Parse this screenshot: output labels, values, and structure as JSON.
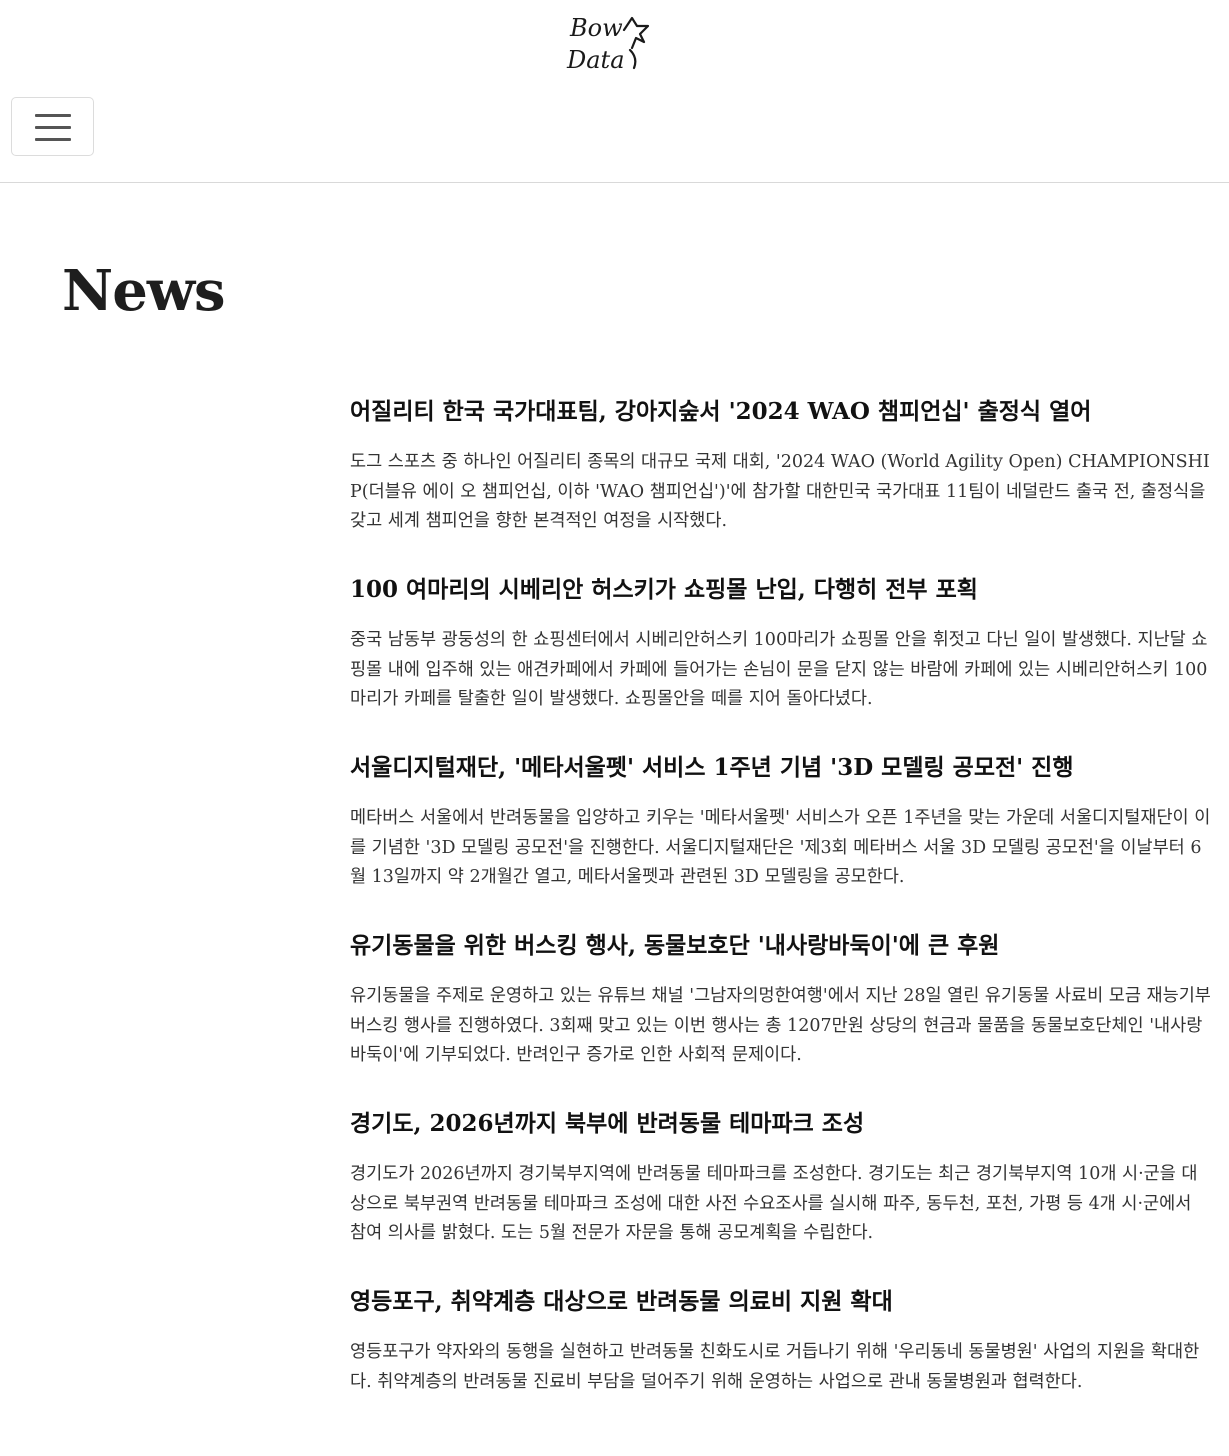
{
  "header": {
    "logo_line1": "Bow",
    "logo_line2": "Data",
    "menu_icon": "hamburger-icon"
  },
  "page": {
    "title": "News"
  },
  "news": [
    {
      "title": "어질리티 한국 국가대표팀, 강아지숲서 '2024 WAO 챔피언십' 출정식 열어",
      "summary": "도그 스포츠 중 하나인 어질리티 종목의 대규모 국제 대회, '2024 WAO (World Agility Open) CHAMPIONSHIP(더블유 에이 오 챔피언십, 이하 'WAO 챔피언십')'에 참가할 대한민국 국가대표 11팀이 네덜란드 출국 전, 출정식을 갖고 세계 챔피언을 향한 본격적인 여정을 시작했다."
    },
    {
      "title": "100 여마리의 시베리안 허스키가 쇼핑몰 난입, 다행히 전부 포획",
      "summary": "중국 남동부 광둥성의 한 쇼핑센터에서 시베리안허스키 100마리가 쇼핑몰 안을 휘젓고 다닌 일이 발생했다. 지난달 쇼핑몰 내에 입주해 있는 애견카페에서 카페에 들어가는 손님이 문을 닫지 않는 바람에 카페에 있는 시베리안허스키 100마리가 카페를 탈출한 일이 발생했다. 쇼핑몰안을 떼를 지어 돌아다녔다."
    },
    {
      "title": "서울디지털재단, '메타서울펫' 서비스 1주년 기념 '3D 모델링 공모전' 진행",
      "summary": "메타버스 서울에서 반려동물을 입양하고 키우는 '메타서울펫' 서비스가 오픈 1주년을 맞는 가운데 서울디지털재단이 이를 기념한 '3D 모델링 공모전'을 진행한다. 서울디지털재단은 '제3회 메타버스 서울 3D 모델링 공모전'을 이날부터 6월 13일까지 약 2개월간 열고, 메타서울펫과 관련된 3D 모델링을 공모한다."
    },
    {
      "title": "유기동물을 위한 버스킹 행사, 동물보호단 '내사랑바둑이'에 큰 후원",
      "summary": "유기동물을 주제로 운영하고 있는 유튜브 채널 '그남자의멍한여행'에서 지난 28일 열린 유기동물 사료비 모금 재능기부 버스킹 행사를 진행하였다. 3회째 맞고 있는 이번 행사는 총 1207만원 상당의 현금과 물품을 동물보호단체인 '내사랑바둑이'에 기부되었다. 반려인구 증가로 인한 사회적 문제이다."
    },
    {
      "title": "경기도, 2026년까지 북부에 반려동물 테마파크 조성",
      "summary": "경기도가 2026년까지 경기북부지역에 반려동물 테마파크를 조성한다. 경기도는 최근 경기북부지역 10개 시·군을 대상으로 북부권역 반려동물 테마파크 조성에 대한 사전 수요조사를 실시해 파주, 동두천, 포천, 가평 등 4개 시·군에서 참여 의사를 밝혔다. 도는 5월 전문가 자문을 통해 공모계획을 수립한다."
    },
    {
      "title": "영등포구, 취약계층 대상으로 반려동물 의료비 지원 확대",
      "summary": "영등포구가 약자와의 동행을 실현하고 반려동물 친화도시로 거듭나기 위해 '우리동네 동물병원' 사업의 지원을 확대한다. 취약계층의 반려동물 진료비 부담을 덜어주기 위해 운영하는 사업으로 관내 동물병원과 협력한다."
    }
  ]
}
